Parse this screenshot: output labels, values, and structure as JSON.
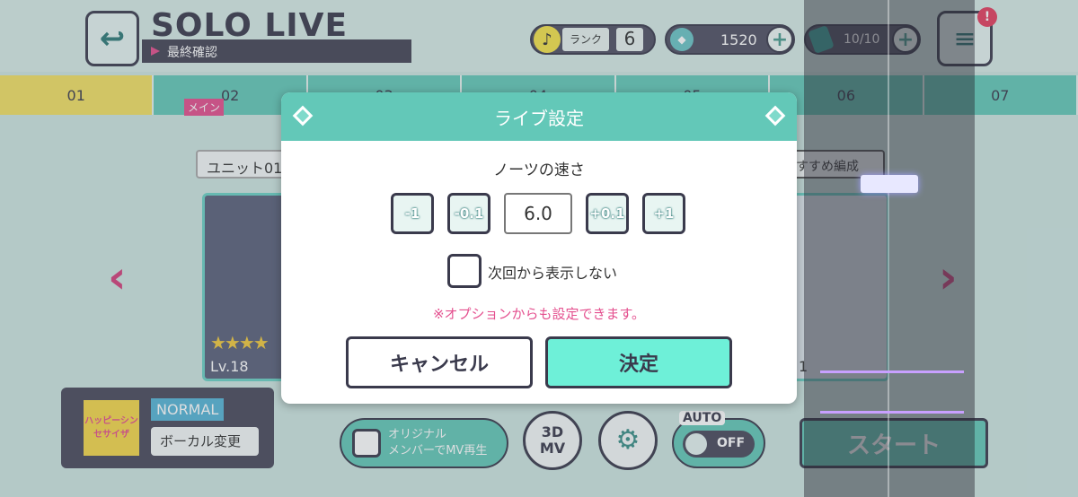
{
  "header": {
    "title": "SOLO LIVE",
    "subtitle": "最終確認",
    "back_icon": "back-arrow-icon"
  },
  "status": {
    "rank_label": "ランク",
    "rank_value": "6",
    "crystals": "1520",
    "stamina": "10/10"
  },
  "tabs": [
    {
      "label": "01"
    },
    {
      "label": "02"
    },
    {
      "label": "03"
    },
    {
      "label": "04"
    },
    {
      "label": "05"
    },
    {
      "label": "06"
    },
    {
      "label": "07"
    }
  ],
  "tab_tag": "メイン",
  "unit": {
    "label": "ユニット01",
    "recommend": "すすめ編成"
  },
  "card": {
    "level": "Lv.18",
    "stars": "★★★★",
    "level2": "1"
  },
  "song": {
    "jacket_text": "ハッピーシンセサイザ",
    "difficulty": "NORMAL",
    "vocal_button": "ボーカル変更"
  },
  "controls": {
    "mv_label": "オリジナル\nメンバーでMV再生",
    "mv3d": "3D\nMV",
    "auto_label": "AUTO",
    "auto_state": "OFF",
    "start": "スタート"
  },
  "modal": {
    "title": "ライブ設定",
    "speed_label": "ノーツの速さ",
    "buttons": [
      "-1",
      "-0.1",
      "+0.1",
      "+1"
    ],
    "speed_value": "6.0",
    "checkbox_label": "次回から表示しない",
    "note": "※オプションからも設定できます。",
    "cancel": "キャンセル",
    "ok": "決定"
  }
}
